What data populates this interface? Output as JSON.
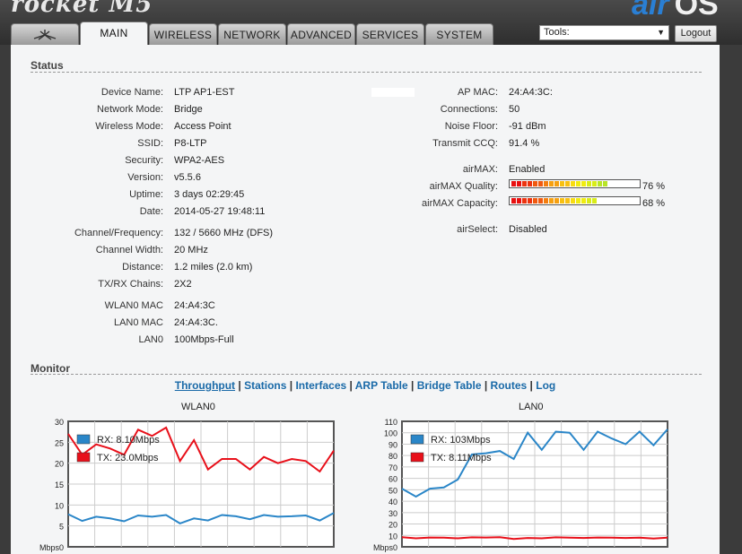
{
  "header": {
    "logo_left": "rocket M5",
    "logo_air": "air",
    "logo_os": "OS"
  },
  "tabs": [
    {
      "label": "",
      "icon": "ubiquiti-logo-icon"
    },
    {
      "label": "MAIN"
    },
    {
      "label": "WIRELESS"
    },
    {
      "label": "NETWORK"
    },
    {
      "label": "ADVANCED"
    },
    {
      "label": "SERVICES"
    },
    {
      "label": "SYSTEM"
    }
  ],
  "toolbar": {
    "tools_value": "Tools:",
    "logout_label": "Logout"
  },
  "status": {
    "heading": "Status",
    "left": [
      {
        "label": "Device Name:",
        "value": "LTP AP1-EST"
      },
      {
        "label": "Network Mode:",
        "value": "Bridge"
      },
      {
        "label": "Wireless Mode:",
        "value": "Access Point"
      },
      {
        "label": "SSID:",
        "value": "P8-LTP"
      },
      {
        "label": "Security:",
        "value": "WPA2-AES"
      },
      {
        "label": "Version:",
        "value": "v5.5.6"
      },
      {
        "label": "Uptime:",
        "value": "3 days 02:29:45"
      },
      {
        "label": "Date:",
        "value": "2014-05-27 19:48:11"
      },
      {
        "label": "Channel/Frequency:",
        "value": "132 / 5660 MHz (DFS)"
      },
      {
        "label": "Channel Width:",
        "value": "20 MHz"
      },
      {
        "label": "Distance:",
        "value": "1.2 miles (2.0 km)"
      },
      {
        "label": "TX/RX Chains:",
        "value": "2X2"
      },
      {
        "label": "WLAN0 MAC",
        "value": "24:A4:3C"
      },
      {
        "label": "LAN0 MAC",
        "value": "24:A4:3C."
      },
      {
        "label": "LAN0",
        "value": "100Mbps-Full"
      }
    ],
    "right": [
      {
        "label": "AP MAC:",
        "value": "24:A4:3C:"
      },
      {
        "label": "Connections:",
        "value": "50"
      },
      {
        "label": "Noise Floor:",
        "value": "-91 dBm"
      },
      {
        "label": "Transmit CCQ:",
        "value": "91.4 %"
      },
      {
        "label": "airMAX:",
        "value": "Enabled"
      },
      {
        "label": "airMAX Quality:",
        "value": "76 %"
      },
      {
        "label": "airMAX Capacity:",
        "value": "68 %"
      },
      {
        "label": "airSelect:",
        "value": "Disabled"
      }
    ],
    "airmax_quality": 76,
    "airmax_capacity": 68
  },
  "monitor": {
    "heading": "Monitor",
    "links": [
      "Throughput",
      "Stations",
      "Interfaces",
      "ARP Table",
      "Bridge Table",
      "Routes",
      "Log"
    ],
    "current": "Throughput"
  },
  "colors": {
    "rx": "#2a86c8",
    "tx": "#e8101a",
    "accent": "#1a6aa8"
  },
  "chart_data": [
    {
      "type": "line",
      "title": "WLAN0",
      "ylabel": "Mbps",
      "ylim": [
        0,
        30
      ],
      "yticks": [
        0,
        5,
        10,
        15,
        20,
        25,
        30
      ],
      "series": [
        {
          "name": "RX: 8.10Mbps",
          "color": "#2a86c8",
          "values": [
            7.8,
            6.2,
            7.2,
            6.8,
            6.1,
            7.5,
            7.2,
            7.6,
            5.6,
            6.8,
            6.3,
            7.6,
            7.3,
            6.6,
            7.6,
            7.2,
            7.3,
            7.5,
            6.3,
            8.1
          ]
        },
        {
          "name": "TX: 23.0Mbps",
          "color": "#e8101a",
          "values": [
            27,
            22,
            24.5,
            23.5,
            22,
            28,
            26.5,
            28.5,
            20.5,
            25.5,
            18.5,
            21,
            21,
            18.5,
            21.5,
            20,
            21,
            20.5,
            18,
            23
          ]
        }
      ]
    },
    {
      "type": "line",
      "title": "LAN0",
      "ylabel": "Mbps",
      "ylim": [
        0,
        110
      ],
      "yticks": [
        0,
        10,
        20,
        30,
        40,
        50,
        60,
        70,
        80,
        90,
        100,
        110
      ],
      "series": [
        {
          "name": "RX: 103Mbps",
          "color": "#2a86c8",
          "values": [
            51,
            44,
            51,
            52,
            59,
            81,
            82,
            84,
            77,
            100,
            85,
            101,
            100,
            85,
            101,
            95,
            90,
            101,
            89,
            103
          ]
        },
        {
          "name": "TX: 8.11Mbps",
          "color": "#e8101a",
          "values": [
            8.5,
            7.5,
            8.2,
            8,
            7.5,
            8.3,
            8.2,
            8.5,
            6.8,
            7.8,
            7.5,
            8.3,
            8,
            7.8,
            8.2,
            8,
            7.8,
            8.1,
            7.3,
            8.1
          ]
        }
      ]
    }
  ]
}
